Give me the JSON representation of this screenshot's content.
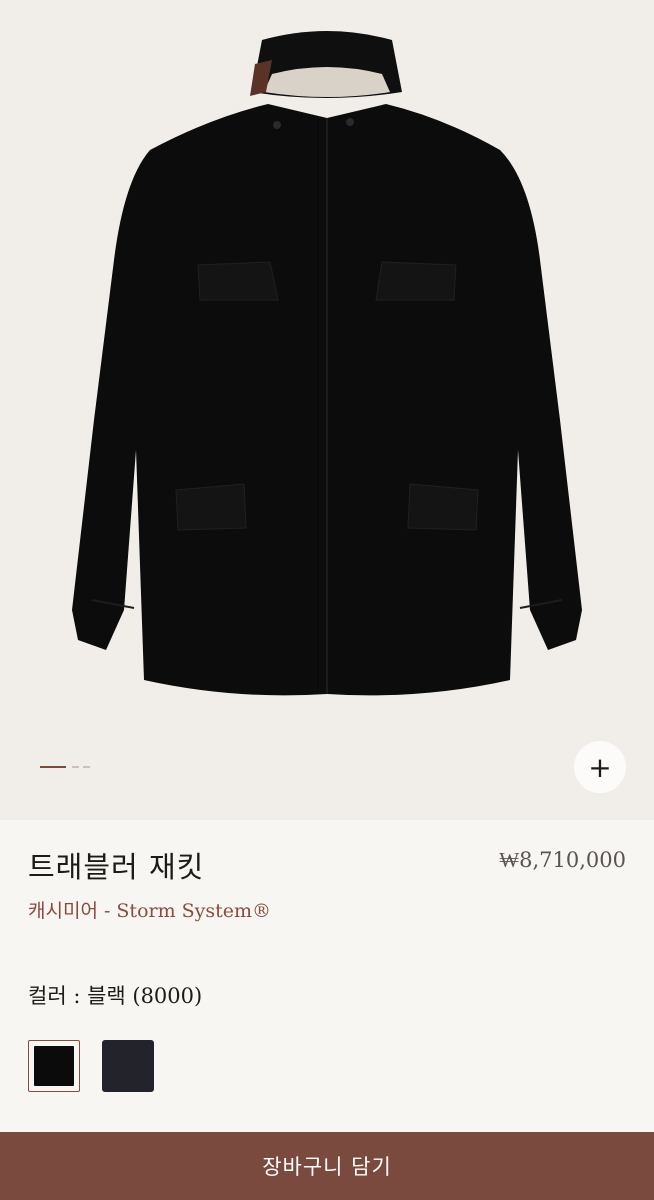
{
  "product": {
    "title": "트래블러 재킷",
    "price": "₩8,710,000",
    "material": "캐시미어 - Storm System®"
  },
  "gallery": {
    "image_subject": "black jacket product photo",
    "zoom_icon": "+",
    "pager_count": 3,
    "pager_active": 1
  },
  "color": {
    "label": "컬러 : 블랙 (8000)",
    "swatches": [
      {
        "name": "black",
        "hex": "#0b0b0b",
        "selected": true
      },
      {
        "name": "navy",
        "hex": "#22232b",
        "selected": false
      }
    ]
  },
  "actions": {
    "add_to_cart": "장바구니 담기"
  },
  "colors": {
    "accent": "#7a4a3f",
    "background": "#f1eeea"
  }
}
